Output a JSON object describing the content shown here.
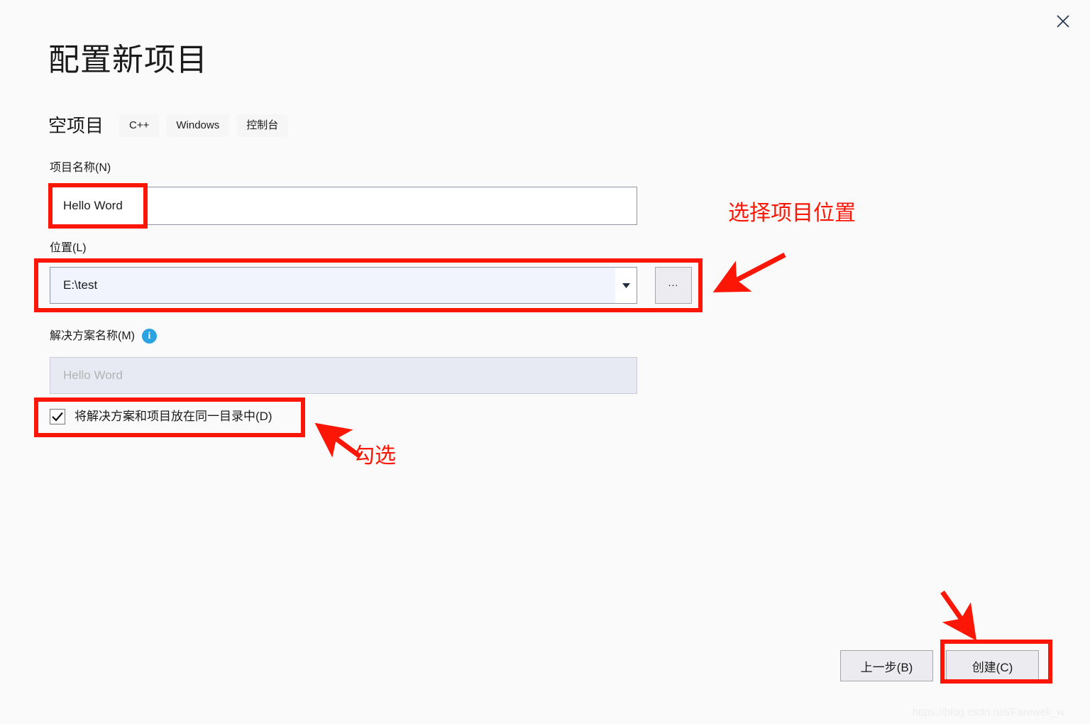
{
  "dialog": {
    "title": "配置新项目",
    "close_icon": "close-icon",
    "template": {
      "name": "空项目",
      "tags": [
        "C++",
        "Windows",
        "控制台"
      ]
    },
    "fields": {
      "project_name": {
        "label": "项目名称(N)",
        "value": "Hello Word",
        "placeholder": ""
      },
      "location": {
        "label": "位置(L)",
        "value": "E:\\test",
        "dropdown_icon": "chevron-down-icon",
        "browse_label": "..."
      },
      "solution_name": {
        "label": "解决方案名称(M)",
        "info_icon": "info-icon",
        "info_glyph": "i",
        "value": "",
        "placeholder": "Hello Word"
      },
      "same_directory": {
        "label": "将解决方案和项目放在同一目录中(D)",
        "checked": true,
        "check_icon": "checkmark-icon"
      }
    },
    "buttons": {
      "back": "上一步(B)",
      "create": "创建(C)"
    }
  },
  "annotations": {
    "accent_color": "#fb1606",
    "location_note": "选择项目位置",
    "checkbox_note": "勾选",
    "boxes": [
      "project-name",
      "location",
      "checkbox",
      "create-button"
    ],
    "arrows": [
      "arrow-to-location",
      "arrow-to-checkbox",
      "arrow-to-create"
    ]
  },
  "watermark": {
    "text": "https://blog.csdn.net/Farewell_w"
  }
}
